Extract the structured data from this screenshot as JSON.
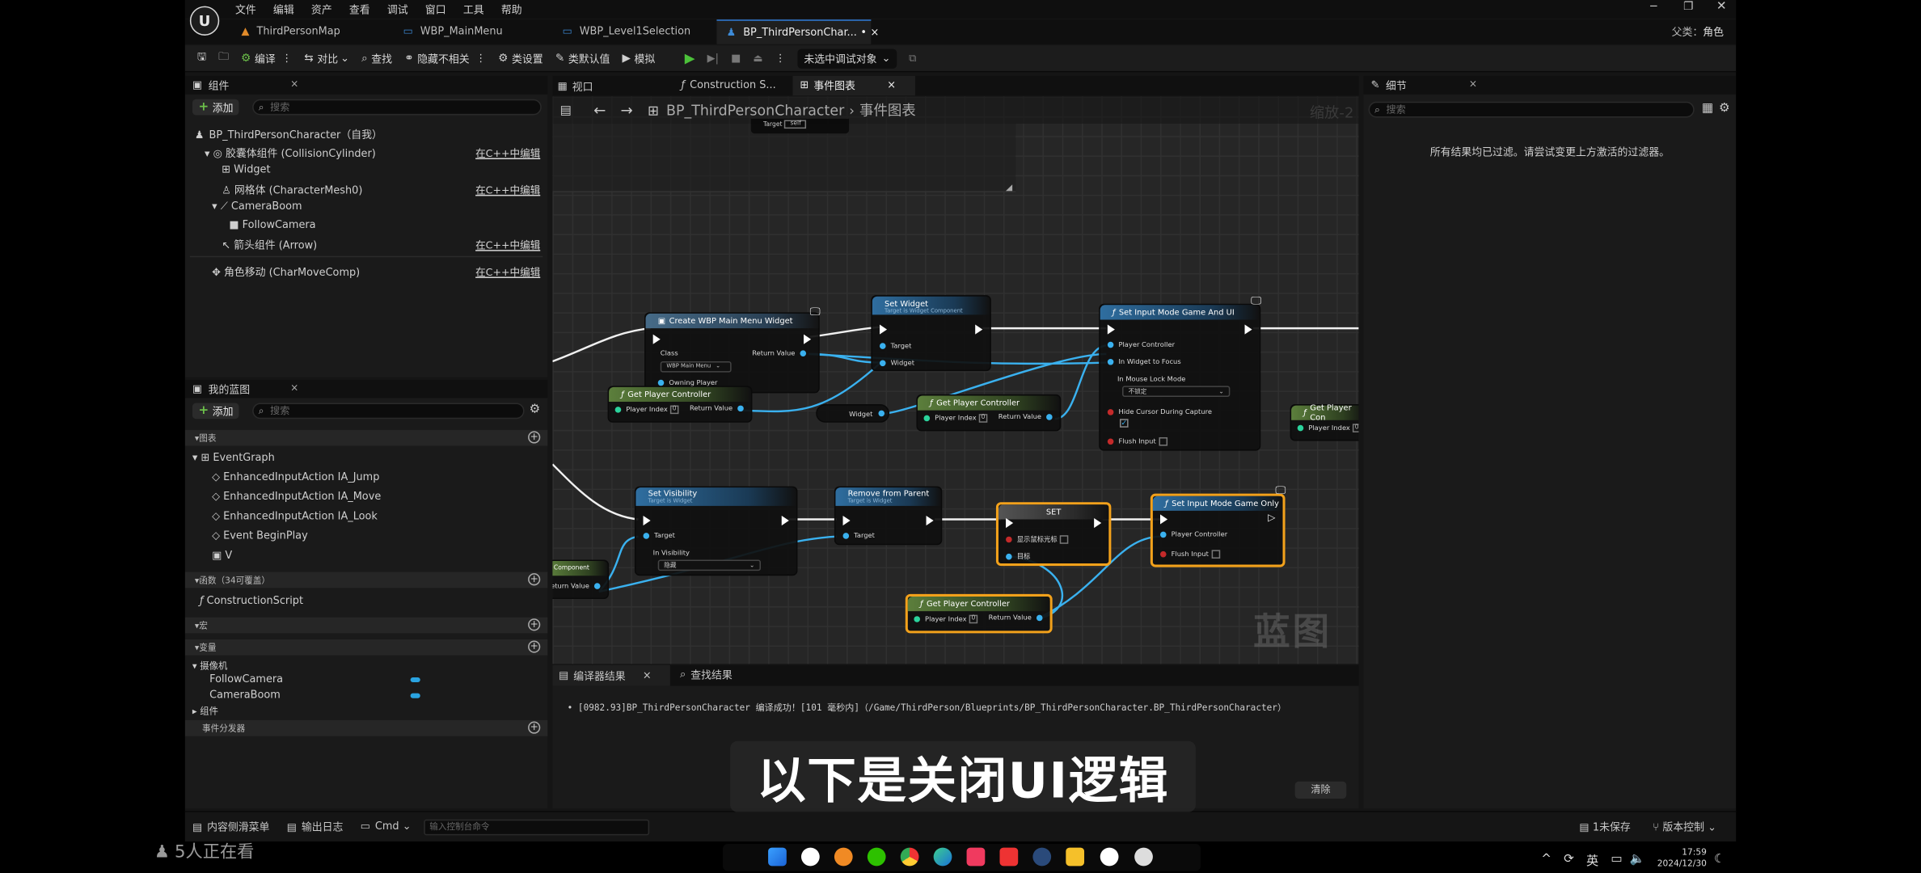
{
  "menu": {
    "items": [
      "文件",
      "编辑",
      "资产",
      "查看",
      "调试",
      "窗口",
      "工具",
      "帮助"
    ],
    "right_label": "父类：",
    "right_value": "角色"
  },
  "tabs": [
    {
      "label": "ThirdPersonMap"
    },
    {
      "label": "WBP_MainMenu"
    },
    {
      "label": "WBP_Level1Selection"
    },
    {
      "label": "BP_ThirdPersonChar...",
      "modified": "•",
      "close": "×"
    }
  ],
  "toolbar": {
    "compile": "编译",
    "diff": "对比",
    "find": "查找",
    "hide": "隐藏不相关",
    "class_settings": "类设置",
    "class_defaults": "类默认值",
    "simulate": "模拟",
    "debug_target": "未选中调试对象"
  },
  "components": {
    "title": "组件",
    "add": "添加",
    "search_placeholder": "搜索",
    "items": [
      {
        "label": "BP_ThirdPersonCharacter（自我）",
        "cpp": ""
      },
      {
        "label": "胶囊体组件 (CollisionCylinder)",
        "cpp": "在C++中编辑"
      },
      {
        "label": "Widget",
        "cpp": ""
      },
      {
        "label": "网格体 (CharacterMesh0)",
        "cpp": "在C++中编辑"
      },
      {
        "label": "CameraBoom",
        "cpp": ""
      },
      {
        "label": "FollowCamera",
        "cpp": ""
      },
      {
        "label": "箭头组件 (Arrow)",
        "cpp": "在C++中编辑"
      },
      {
        "label": "角色移动 (CharMoveComp)",
        "cpp": "在C++中编辑"
      }
    ]
  },
  "my_blueprint": {
    "title": "我的蓝图",
    "add": "添加",
    "search_placeholder": "搜索",
    "graphs_section": "图表",
    "event_graph": "EventGraph",
    "events": [
      "EnhancedInputAction IA_Jump",
      "EnhancedInputAction IA_Move",
      "EnhancedInputAction IA_Look",
      "Event BeginPlay",
      "V"
    ],
    "functions_section": "函数（34可覆盖）",
    "function_item": "ConstructionScript",
    "macros_section": "宏",
    "variables_section": "变量",
    "var_category": "摄像机",
    "variables": [
      "FollowCamera",
      "CameraBoom"
    ],
    "components_cat": "组件",
    "dispatchers_section": "事件分发器"
  },
  "graph": {
    "tabs": [
      "视口",
      "Construction S...",
      "事件图表"
    ],
    "breadcrumb_root": "BP_ThirdPersonCharacter",
    "breadcrumb_leaf": "事件图表",
    "zoom": "缩放-2",
    "watermark": "蓝图",
    "top_pin": "Target",
    "nodes": {
      "create_widget": {
        "title": "Create WBP Main Menu Widget",
        "class": "Class",
        "class_value": "WBP Main Menu",
        "return": "Return Value",
        "owning": "Owning Player"
      },
      "set_widget": {
        "title": "Set Widget",
        "sub": "Target is Widget Component",
        "target": "Target",
        "widget": "Widget"
      },
      "set_input_ui": {
        "title": "Set Input Mode Game And UI",
        "pc": "Player Controller",
        "focus": "In Widget to Focus",
        "lock": "In Mouse Lock Mode",
        "lock_value": "不锁定",
        "hide": "Hide Cursor During Capture",
        "flush": "Flush Input"
      },
      "gpc1": {
        "title": "Get Player Controller",
        "index": "Player Index",
        "val": "0",
        "return": "Return Value"
      },
      "widget_var": {
        "title": "Widget"
      },
      "gpc2": {
        "title": "Get Player Controller",
        "index": "Player Index",
        "val": "0",
        "return": "Return Value"
      },
      "gpc3": {
        "title": "Get Player Con",
        "index": "Player Index",
        "val": "0"
      },
      "set_vis": {
        "title": "Set Visibility",
        "sub": "Target is Widget",
        "target": "Target",
        "vis": "In Visibility",
        "vis_value": "隐藏"
      },
      "remove": {
        "title": "Remove from Parent",
        "sub": "Target is Widget",
        "target": "Target"
      },
      "set": {
        "title": "SET",
        "show": "显示鼠标光标",
        "target": "目标"
      },
      "set_game": {
        "title": "Set Input Mode Game Only",
        "pc": "Player Controller",
        "flush": "Flush Input"
      },
      "gpc4": {
        "title": "Get Player Controller",
        "index": "Player Index",
        "val": "0",
        "return": "Return Value"
      },
      "comp": {
        "title": "Component",
        "return": "Return Value"
      }
    }
  },
  "details": {
    "title": "细节",
    "search_placeholder": "搜索",
    "message": "所有结果均已过滤。请尝试变更上方激活的过滤器。"
  },
  "output": {
    "tab1": "编译器结果",
    "tab2": "查找结果",
    "log": "[0982.93]BP_ThirdPersonCharacter 编译成功！[101 毫秒内]（/Game/ThirdPerson/Blueprints/BP_ThirdPersonCharacter.BP_ThirdPersonCharacter）",
    "clear": "清除"
  },
  "status": {
    "drawer": "内容侧滑菜单",
    "log": "输出日志",
    "cmd": "Cmd",
    "console_placeholder": "输入控制台命令",
    "unsaved": "1未保存",
    "source": "版本控制"
  },
  "overlay": {
    "viewers": "5人正在看",
    "subtitle": "以下是关闭UI逻辑"
  },
  "taskbar": {
    "ime": "英",
    "time": "17:59",
    "date": "2024/12/30"
  }
}
